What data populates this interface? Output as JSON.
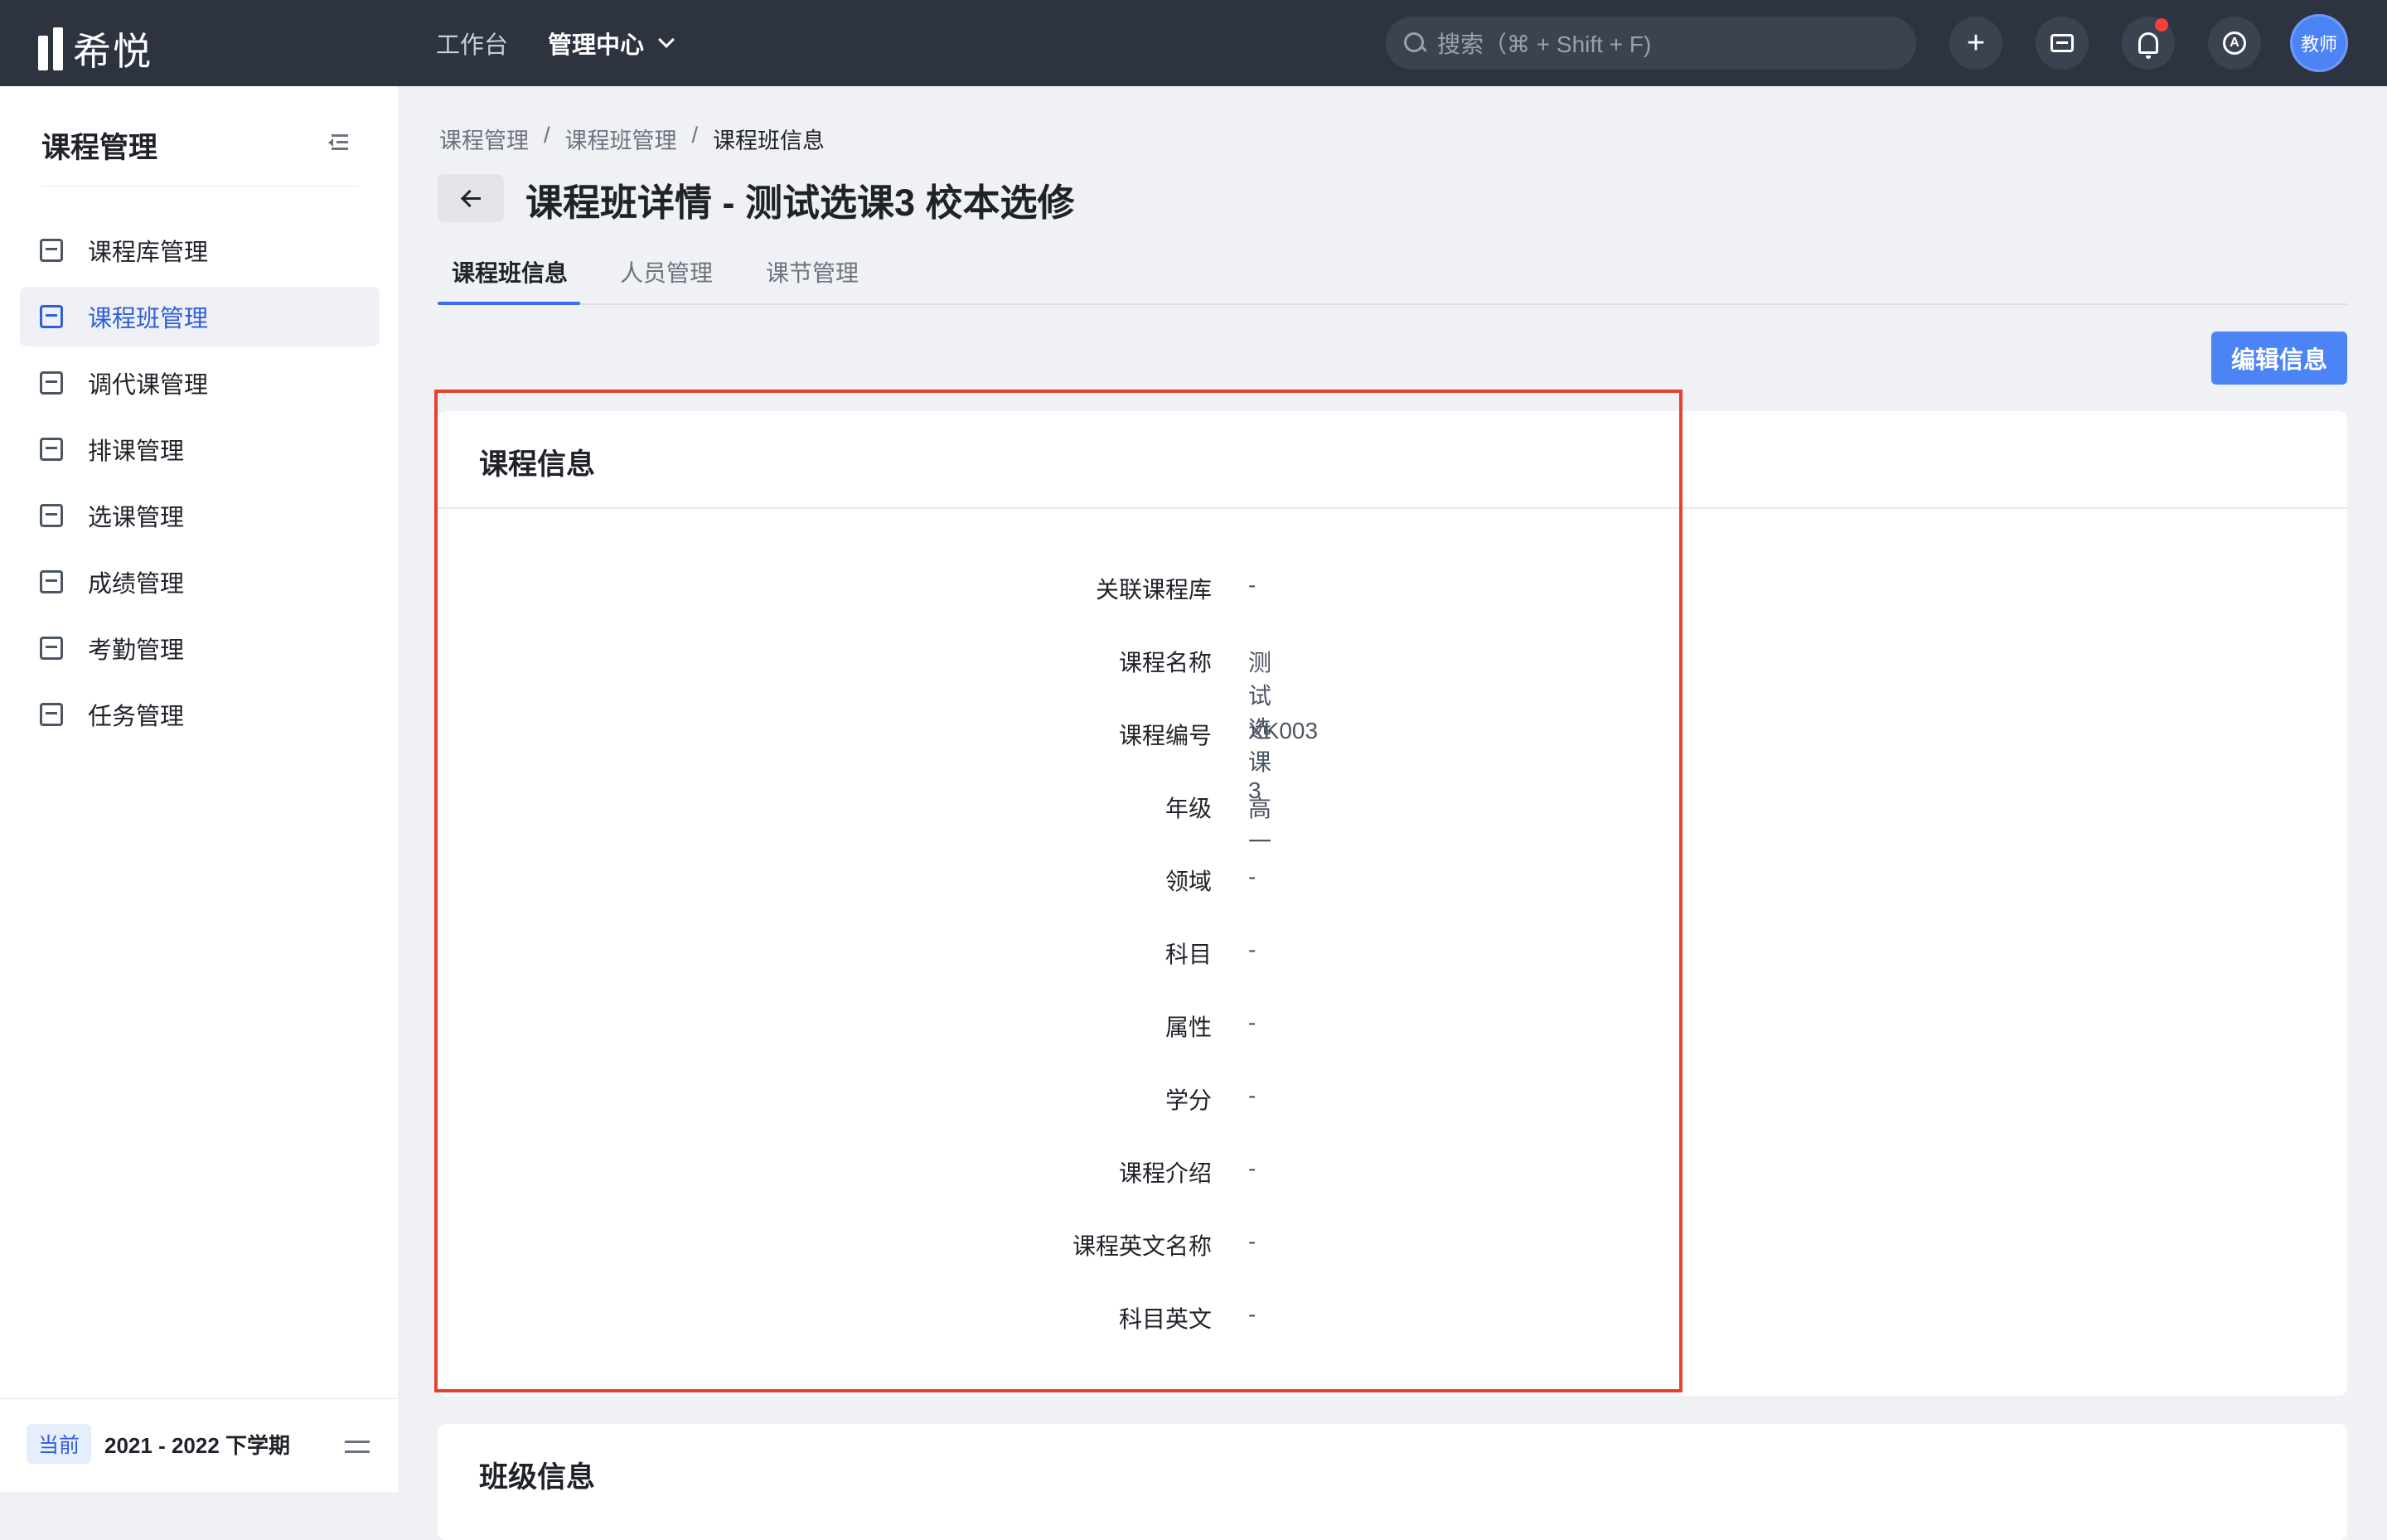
{
  "app": {
    "name": "希悦"
  },
  "topnav": {
    "workbench": "工作台",
    "admin_center": "管理中心"
  },
  "search": {
    "placeholder": "搜索（⌘ + Shift + F)"
  },
  "header_icons": [
    "plus-icon",
    "message-icon",
    "bell-icon",
    "help-icon"
  ],
  "user": {
    "avatar_label": "教师"
  },
  "sidebar": {
    "title": "课程管理",
    "items": [
      {
        "label": "课程库管理",
        "icon": "library-icon"
      },
      {
        "label": "课程班管理",
        "icon": "class-icon",
        "active": true
      },
      {
        "label": "调代课管理",
        "icon": "swap-class-icon"
      },
      {
        "label": "排课管理",
        "icon": "schedule-icon"
      },
      {
        "label": "选课管理",
        "icon": "select-course-icon"
      },
      {
        "label": "成绩管理",
        "icon": "grade-icon"
      },
      {
        "label": "考勤管理",
        "icon": "attendance-icon"
      },
      {
        "label": "任务管理",
        "icon": "task-icon"
      }
    ],
    "term_badge": "当前",
    "term": "2021 - 2022 下学期"
  },
  "breadcrumb": [
    "课程管理",
    "课程班管理",
    "课程班信息"
  ],
  "page": {
    "title": "课程班详情 - 测试选课3 校本选修"
  },
  "tabs": [
    "课程班信息",
    "人员管理",
    "课节管理"
  ],
  "actions": {
    "edit": "编辑信息"
  },
  "course_info": {
    "title": "课程信息",
    "fields": [
      {
        "label": "关联课程库",
        "value": "-"
      },
      {
        "label": "课程名称",
        "value": "测试选课3"
      },
      {
        "label": "课程编号",
        "value": "XK003"
      },
      {
        "label": "年级",
        "value": "高一"
      },
      {
        "label": "领域",
        "value": "-"
      },
      {
        "label": "科目",
        "value": "-"
      },
      {
        "label": "属性",
        "value": "-"
      },
      {
        "label": "学分",
        "value": "-"
      },
      {
        "label": "课程介绍",
        "value": "-"
      },
      {
        "label": "课程英文名称",
        "value": "-"
      },
      {
        "label": "科目英文",
        "value": "-"
      }
    ]
  },
  "class_info": {
    "title": "班级信息"
  },
  "colors": {
    "topbar": "#2d3440",
    "accent": "#4d84f5",
    "highlight": "#e5412f",
    "active_text": "#2f5fd8"
  }
}
